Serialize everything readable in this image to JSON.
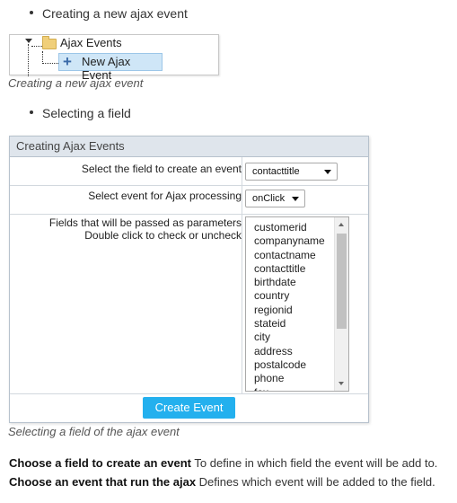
{
  "bullets": [
    "Creating a new ajax event",
    "Selecting a field"
  ],
  "tree": {
    "folder_label": "Ajax Events",
    "item_label": "New Ajax Event"
  },
  "captions": [
    "Creating a new ajax event",
    "Selecting a field of the ajax event"
  ],
  "panel": {
    "title": "Creating Ajax Events",
    "field_label": "Select the field to create an event",
    "field_value": "contacttitle",
    "event_label": "Select event for Ajax processing",
    "event_value": "onClick",
    "params_label_1": "Fields that will be passed as parameters",
    "params_label_2": "Double click to check or uncheck",
    "params_list": [
      "customerid",
      "companyname",
      "contactname",
      "contacttitle",
      "birthdate",
      "country",
      "regionid",
      "stateid",
      "city",
      "address",
      "postalcode",
      "phone",
      "fax"
    ],
    "button_label": "Create Event"
  },
  "descriptions": [
    {
      "term": "Choose a field to create an event",
      "text": "To define in which field the event will be add to."
    },
    {
      "term": "Choose an event that run the ajax",
      "text": "Defines which event will be added to the field."
    }
  ]
}
